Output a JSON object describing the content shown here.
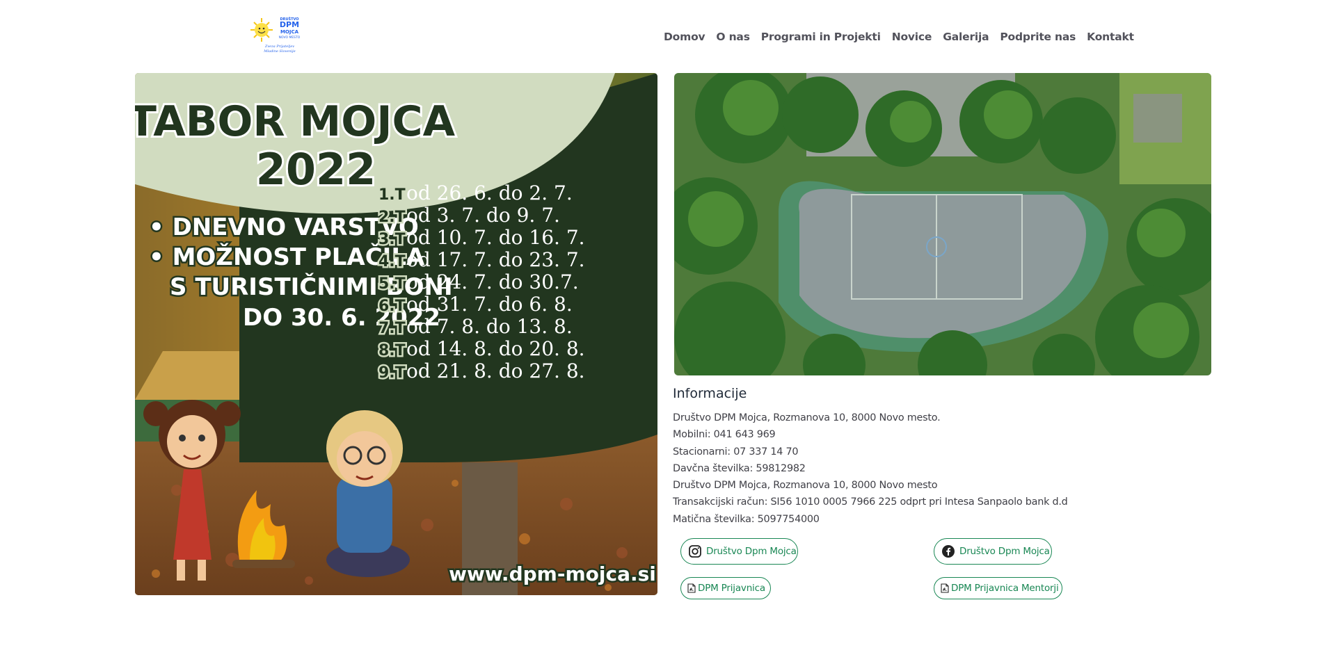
{
  "header": {
    "logo_alt": "Društvo DPM Mojca Novo mesto",
    "logo_text_top": "DRUŠTVO",
    "logo_text_main": "DPM",
    "logo_text_sub": "MOJCA",
    "logo_text_city": "NOVO MESTO",
    "logo_tagline_1": "Zveza Prijateljev",
    "logo_tagline_2": "Mladine Slovenije",
    "nav": [
      {
        "label": "Domov"
      },
      {
        "label": "O nas"
      },
      {
        "label": "Programi in Projekti"
      },
      {
        "label": "Novice"
      },
      {
        "label": "Galerija"
      },
      {
        "label": "Podprite nas"
      },
      {
        "label": "Kontakt"
      }
    ]
  },
  "poster": {
    "title_line1": "TABOR MOJCA",
    "title_line2": "2022",
    "bullet1": "• DNEVNO VARSTVO",
    "bullet2": "• MOŽNOST PLAČILA",
    "bullet2b": "S TURISTIČNIMI BONI",
    "bullet2c": "DO 30. 6. 2022",
    "terms": [
      {
        "tag": "1.T",
        "dates": "od 26. 6. do 2. 7."
      },
      {
        "tag": "2.T",
        "dates": "od 3. 7. do 9. 7."
      },
      {
        "tag": "3.T",
        "dates": "od 10. 7. do 16. 7."
      },
      {
        "tag": "4.T",
        "dates": "od 17. 7. do 23. 7."
      },
      {
        "tag": "5.T",
        "dates": "od 24. 7. do 30.7."
      },
      {
        "tag": "6.T",
        "dates": "od 31. 7. do 6. 8."
      },
      {
        "tag": "7.T",
        "dates": "od 7. 8. do 13. 8."
      },
      {
        "tag": "8.T",
        "dates": "od 14. 8. do 20. 8."
      },
      {
        "tag": "9.T",
        "dates": "od 21. 8. do 27. 8."
      }
    ],
    "website": "www.dpm-mojca.si"
  },
  "info": {
    "title": "Informacije",
    "lines": [
      "Društvo DPM Mojca, Rozmanova 10, 8000 Novo mesto.",
      "Mobilni: 041 643 969",
      "Stacionarni: 07 337 14 70",
      "Davčna številka: 59812982",
      "Društvo DPM Mojca, Rozmanova 10, 8000 Novo mesto",
      "Transakcijski račun: SI56 1010 0005 7966 225 odprt pri Intesa Sanpaolo bank d.d",
      "Matična številka: 5097754000"
    ],
    "links": {
      "instagram": "Društvo Dpm Mojca",
      "facebook": "Društvo Dpm Mojca",
      "prijavnica": "DPM Prijavnica",
      "prijavnica_mentorji": "DPM Prijavnica Mentorji"
    }
  },
  "colors": {
    "accent": "#198754",
    "nav_text": "#52525b",
    "poster_dark_green": "#22361f",
    "poster_light_green": "#d1dcc0"
  }
}
